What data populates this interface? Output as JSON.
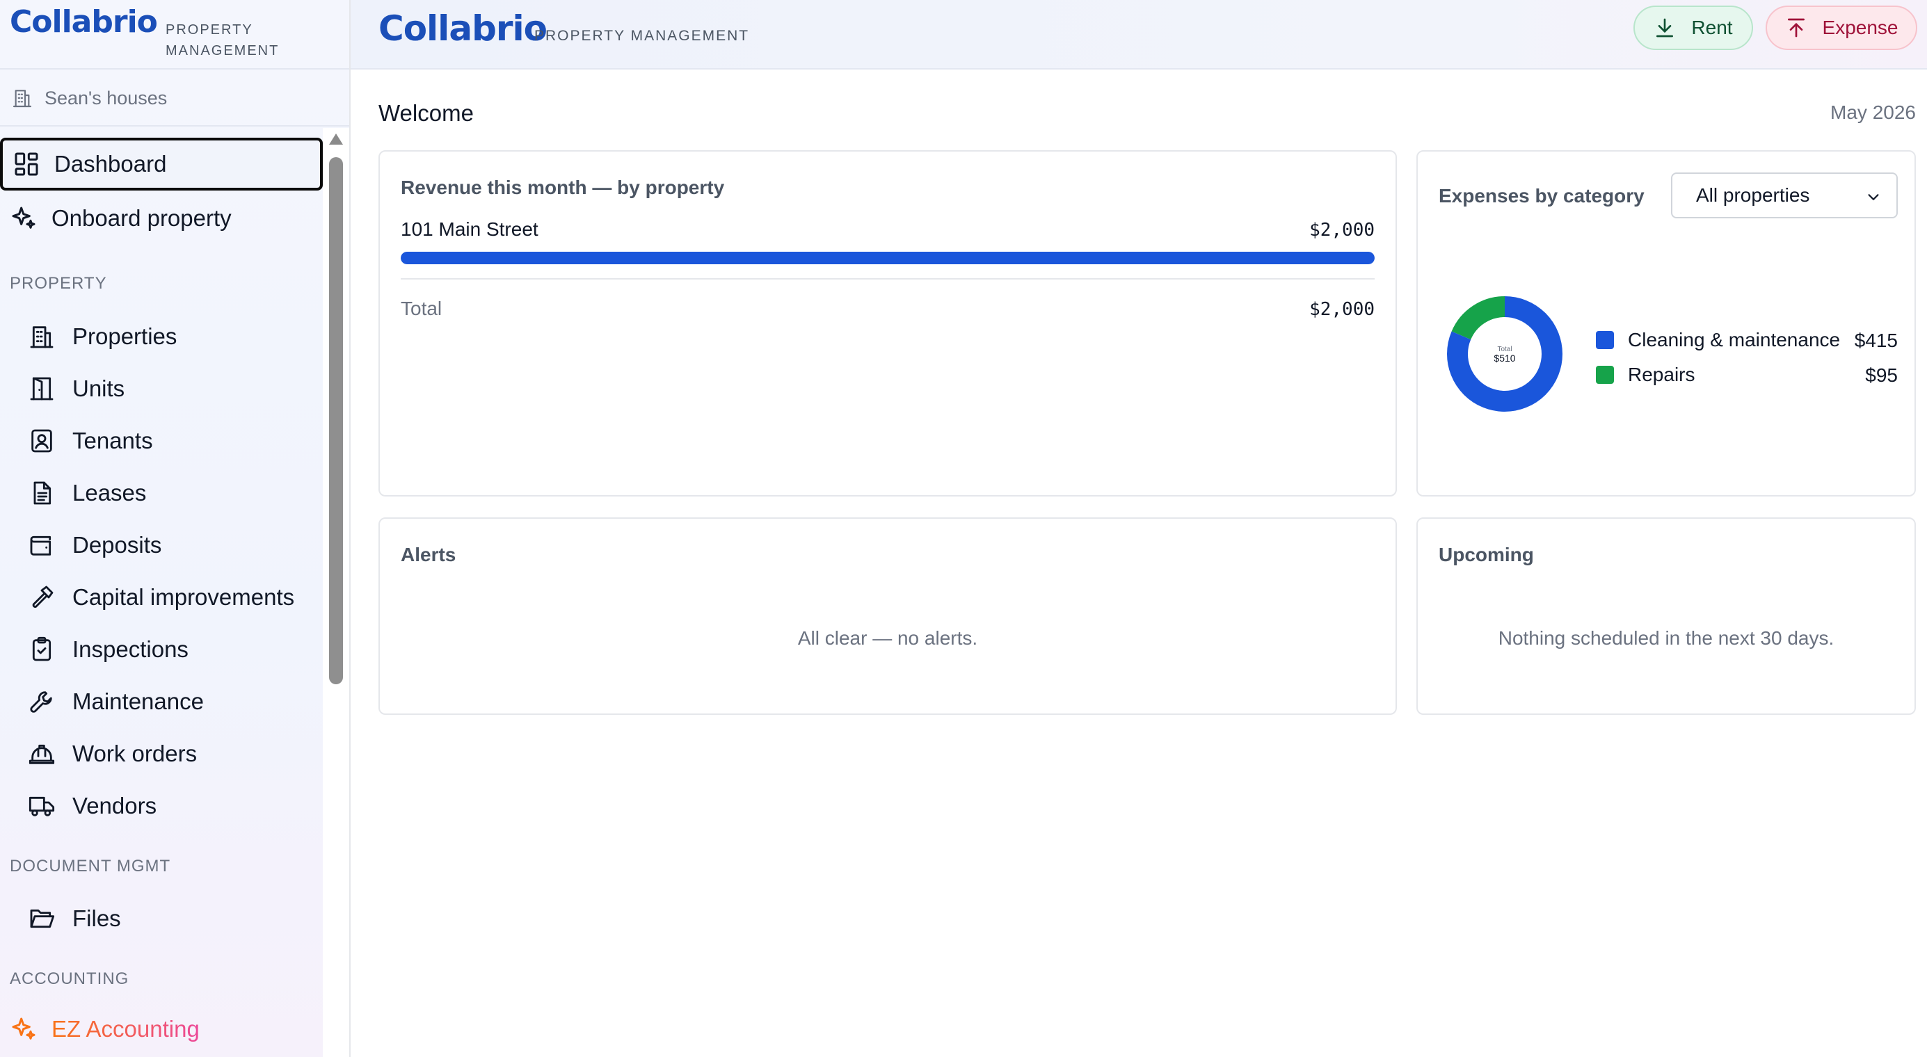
{
  "brand": {
    "name": "Collabrio",
    "subtitle": "PROPERTY MANAGEMENT",
    "sidebar_subtitle_line1": "PROPERTY",
    "sidebar_subtitle_line2": "MANAGEMENT"
  },
  "workspace": {
    "name": "Sean's houses",
    "icon": "building-icon"
  },
  "nav": {
    "top": [
      {
        "label": "Dashboard",
        "icon": "dashboard-grid-icon",
        "active": true
      },
      {
        "label": "Onboard property",
        "icon": "sparkle-icon"
      }
    ],
    "sections": [
      {
        "title": "PROPERTY",
        "items": [
          {
            "label": "Properties",
            "icon": "building-icon"
          },
          {
            "label": "Units",
            "icon": "door-icon"
          },
          {
            "label": "Tenants",
            "icon": "tenant-contact-icon"
          },
          {
            "label": "Leases",
            "icon": "document-icon"
          },
          {
            "label": "Deposits",
            "icon": "wallet-icon"
          },
          {
            "label": "Capital improvements",
            "icon": "hammer-icon"
          },
          {
            "label": "Inspections",
            "icon": "clipboard-check-icon"
          },
          {
            "label": "Maintenance",
            "icon": "wrench-icon"
          },
          {
            "label": "Work orders",
            "icon": "hard-hat-icon"
          },
          {
            "label": "Vendors",
            "icon": "truck-icon"
          }
        ]
      },
      {
        "title": "DOCUMENT MGMT",
        "items": [
          {
            "label": "Files",
            "icon": "folder-open-icon"
          }
        ]
      },
      {
        "title": "ACCOUNTING",
        "items": [
          {
            "label": "EZ Accounting",
            "icon": "sparkle-icon"
          }
        ]
      }
    ]
  },
  "header": {
    "rent_button": {
      "label": "Rent",
      "icon": "download-arrow-icon"
    },
    "expense_button": {
      "label": "Expense",
      "icon": "upload-arrow-icon"
    }
  },
  "main": {
    "title": "Welcome",
    "period": "May 2026",
    "revenue": {
      "title": "Revenue this month — by property",
      "rows": [
        {
          "name": "101 Main Street",
          "amount": "$2,000",
          "fraction": 1.0
        }
      ],
      "total_label": "Total",
      "total": "$2,000"
    },
    "expenses": {
      "title": "Expenses by category",
      "filter": "All properties",
      "center_label": "Total",
      "center_value": "$510",
      "categories": [
        {
          "name": "Cleaning & maintenance",
          "amount": "$415",
          "value": 415,
          "color": "#1a56db"
        },
        {
          "name": "Repairs",
          "amount": "$95",
          "value": 95,
          "color": "#16a34a"
        }
      ]
    },
    "alerts": {
      "title": "Alerts",
      "empty": "All clear — no alerts."
    },
    "upcoming": {
      "title": "Upcoming",
      "empty": "Nothing scheduled in the next 30 days."
    }
  },
  "colors": {
    "accent": "#1a56db",
    "green": "#16a34a",
    "expense": "#9f1239",
    "rent": "#0f5132"
  }
}
